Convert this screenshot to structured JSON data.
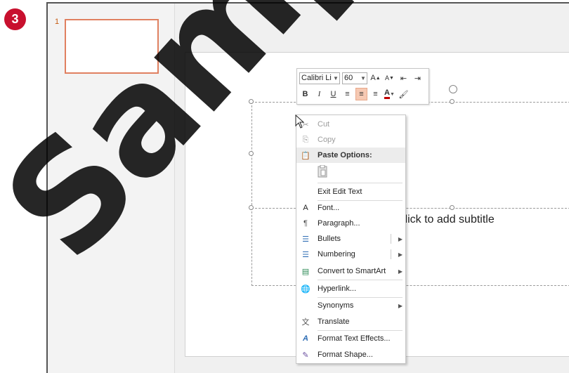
{
  "step_number": "3",
  "thumbnail": {
    "slide_number": "1"
  },
  "placeholder": {
    "subtitle_hint": "Click to add subtitle"
  },
  "mini_toolbar": {
    "font_name": "Calibri Li",
    "font_size": "60",
    "buttons": [
      "A",
      "A",
      "B",
      "I",
      "U"
    ],
    "font_color": "#c00000",
    "accent": "#f6c9b3"
  },
  "context_menu": {
    "cut": "Cut",
    "copy": "Copy",
    "paste_options": "Paste Options:",
    "exit_edit_text": "Exit Edit Text",
    "font": "Font...",
    "paragraph": "Paragraph...",
    "bullets": "Bullets",
    "numbering": "Numbering",
    "convert_smartart": "Convert to SmartArt",
    "hyperlink": "Hyperlink...",
    "synonyms": "Synonyms",
    "translate": "Translate",
    "format_text_effects": "Format Text Effects...",
    "format_shape": "Format Shape..."
  },
  "watermark": "Sample"
}
